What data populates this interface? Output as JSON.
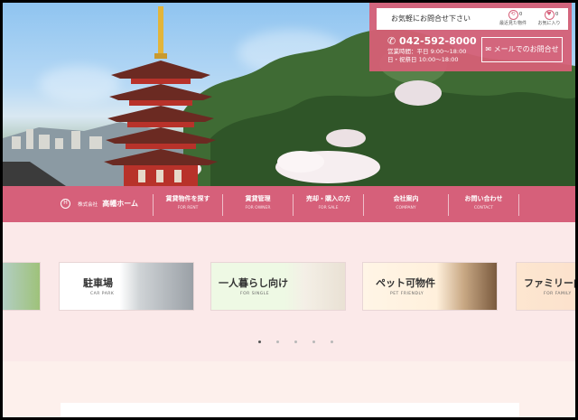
{
  "contact": {
    "inquiry_text": "お気軽にお問合せ下さい",
    "recent_label": "最近見た物件",
    "recent_count": "0",
    "favorites_label": "お気に入り",
    "favorites_count": "0",
    "phone": "042-592-8000",
    "hours_line1": "営業時間：平日 9:00～18:00",
    "hours_line2": "日・祝祭日 10:00～18:00",
    "mail_label": "メールでのお問合せ",
    "accent_color": "#d6607a"
  },
  "brand": {
    "prefix": "株式会社",
    "name": "高幡ホーム"
  },
  "nav": [
    {
      "ja": "賃貸物件を探す",
      "en": "FOR RENT"
    },
    {
      "ja": "賃貸管理",
      "en": "FOR OWNER"
    },
    {
      "ja": "売却・購入の方",
      "en": "FOR SALE"
    },
    {
      "ja": "会社案内",
      "en": "COMPANY"
    },
    {
      "ja": "お問い合わせ",
      "en": "CONTACT"
    }
  ],
  "cards": [
    {
      "title": "駐車場",
      "sub": "CAR PARK"
    },
    {
      "title": "一人暮らし向け",
      "sub": "FOR SINGLE"
    },
    {
      "title": "ペット可物件",
      "sub": "PET FRIENDLY"
    },
    {
      "title": "ファミリー向",
      "sub": "FOR FAMILY"
    }
  ],
  "carousel_dot_count": 5,
  "carousel_active_dot": 1
}
